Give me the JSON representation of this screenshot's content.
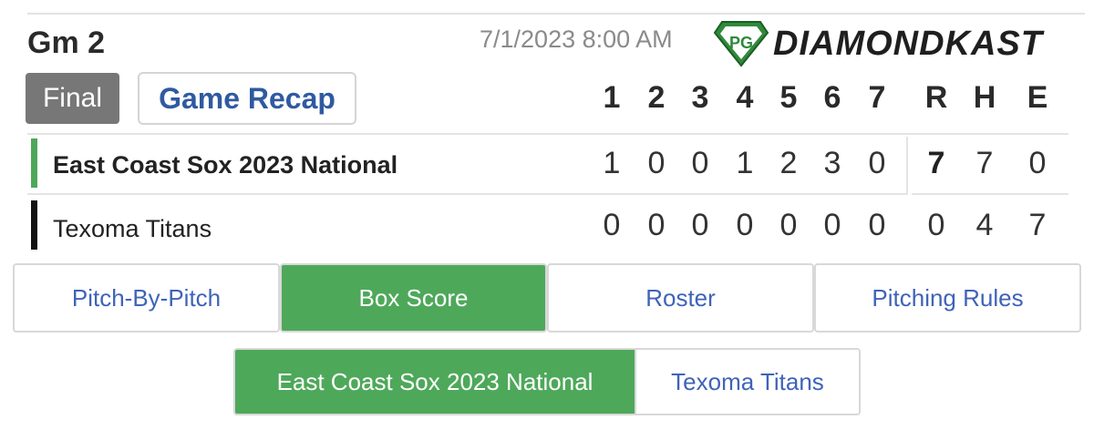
{
  "header": {
    "game_label": "Gm 2",
    "datetime": "7/1/2023 8:00 AM",
    "logo_text": "DIAMONDKAST",
    "logo_monogram": "PG"
  },
  "status": {
    "final_label": "Final",
    "recap_label": "Game Recap"
  },
  "linescore": {
    "innings": [
      "1",
      "2",
      "3",
      "4",
      "5",
      "6",
      "7"
    ],
    "totals_headers": [
      "R",
      "H",
      "E"
    ],
    "teams": [
      {
        "name": "East Coast Sox 2023 National",
        "bar_color": "#4ea85a",
        "innings": [
          "1",
          "0",
          "0",
          "1",
          "2",
          "3",
          "0"
        ],
        "r": "7",
        "h": "7",
        "e": "0"
      },
      {
        "name": "Texoma Titans",
        "bar_color": "#111111",
        "innings": [
          "0",
          "0",
          "0",
          "0",
          "0",
          "0",
          "0"
        ],
        "r": "0",
        "h": "4",
        "e": "7"
      }
    ]
  },
  "tabs": [
    {
      "label": "Pitch-By-Pitch",
      "active": false
    },
    {
      "label": "Box Score",
      "active": true
    },
    {
      "label": "Roster",
      "active": false
    },
    {
      "label": "Pitching Rules",
      "active": false
    }
  ],
  "team_toggle": [
    {
      "label": "East Coast Sox 2023 National",
      "active": true
    },
    {
      "label": "Texoma Titans",
      "active": false
    }
  ],
  "colors": {
    "accent_green": "#4ea85a",
    "link_blue": "#3f63b8",
    "final_gray": "#777777"
  }
}
